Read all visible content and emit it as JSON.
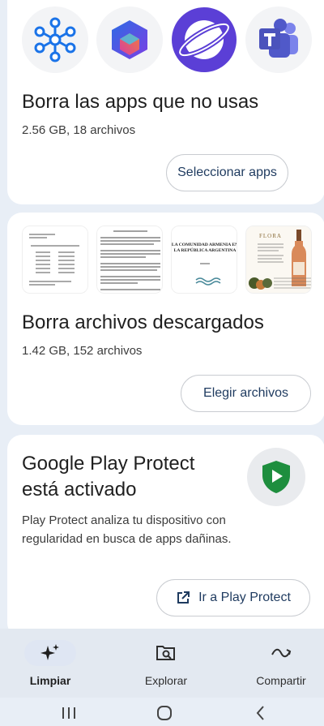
{
  "apps_card": {
    "apps": [
      {
        "icon": "network-hub-icon"
      },
      {
        "icon": "microsoft-365-icon"
      },
      {
        "icon": "samsung-internet-icon"
      },
      {
        "icon": "teams-icon"
      }
    ],
    "title": "Borra las apps que no usas",
    "subtitle": "2.56 GB, 18 archivos",
    "button": "Seleccionar apps"
  },
  "files_card": {
    "thumbnails": [
      {
        "icon": "document-thumbnail"
      },
      {
        "icon": "document-thumbnail"
      },
      {
        "icon": "document-thumbnail",
        "text": "LA COMUNIDAD ARMENIA EN LA REPÚBLICA ARGENTINA"
      },
      {
        "icon": "wine-label-thumbnail",
        "text": "FLORA"
      }
    ],
    "title": "Borra archivos descargados",
    "subtitle": "1.42 GB, 152 archivos",
    "button": "Elegir archivos"
  },
  "protect_card": {
    "title_line1": "Google Play Protect",
    "title_line2": "está activado",
    "description": "Play Protect analiza tu dispositivo con regularidad en busca de apps dañinas.",
    "button": "Ir a Play Protect",
    "icon": "play-protect-shield-icon"
  },
  "bottom_nav": [
    {
      "label": "Limpiar",
      "icon": "sparkle-icon",
      "active": true
    },
    {
      "label": "Explorar",
      "icon": "folder-search-icon",
      "active": false
    },
    {
      "label": "Compartir",
      "icon": "share-swap-icon",
      "active": false
    }
  ],
  "colors": {
    "background": "#e8eef6",
    "card": "#ffffff",
    "button_text": "#1e3a5f",
    "protect_green": "#1e8e3e"
  }
}
